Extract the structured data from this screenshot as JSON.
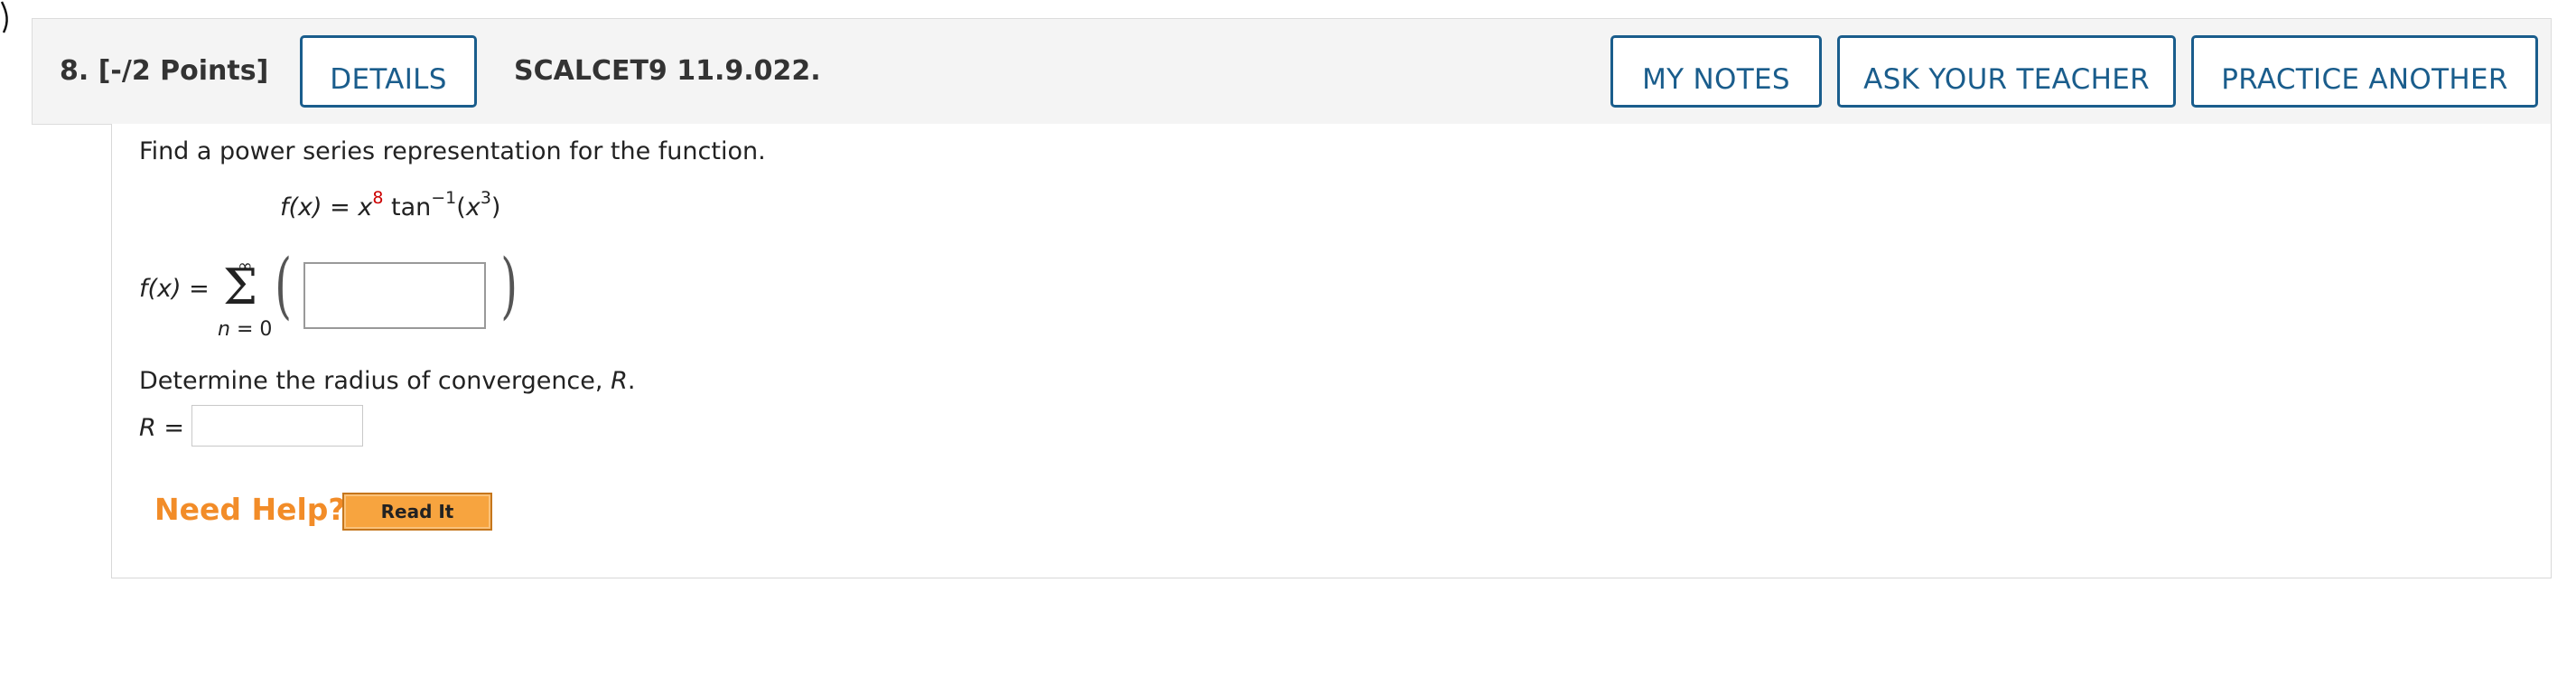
{
  "header": {
    "question_label": "8.  [-/2 Points]",
    "details_label": "DETAILS",
    "problem_code": "SCALCET9 11.9.022.",
    "my_notes_label": "MY NOTES",
    "ask_teacher_label": "ASK YOUR TEACHER",
    "practice_another_label": "PRACTICE ANOTHER"
  },
  "problem": {
    "prompt": "Find a power series representation for the function.",
    "function": {
      "lhs": "f(x)",
      "eq": " = ",
      "base": "x",
      "exponent": "8",
      "op": " tan",
      "inv_exp": "−1",
      "arg_open": "(",
      "arg_base": "x",
      "arg_exp": "3",
      "arg_close": ")"
    },
    "series": {
      "lhs": "f(x)",
      "eq": " =",
      "upper_limit": "∞",
      "sigma": "Σ",
      "index": "n",
      "lower_limit": " = 0",
      "term_value": ""
    },
    "radius_prompt_text": "Determine the radius of convergence, ",
    "radius_symbol": "R",
    "radius_period": ".",
    "radius_lhs": "R",
    "radius_eq": " =",
    "radius_value": ""
  },
  "help": {
    "need_help_label": "Need Help?",
    "read_it_label": "Read It"
  },
  "colors": {
    "button_border": "#1a5d8c",
    "exponent_highlight": "#cc0000",
    "need_help": "#f28c28",
    "read_it_bg": "#f7a43f"
  }
}
